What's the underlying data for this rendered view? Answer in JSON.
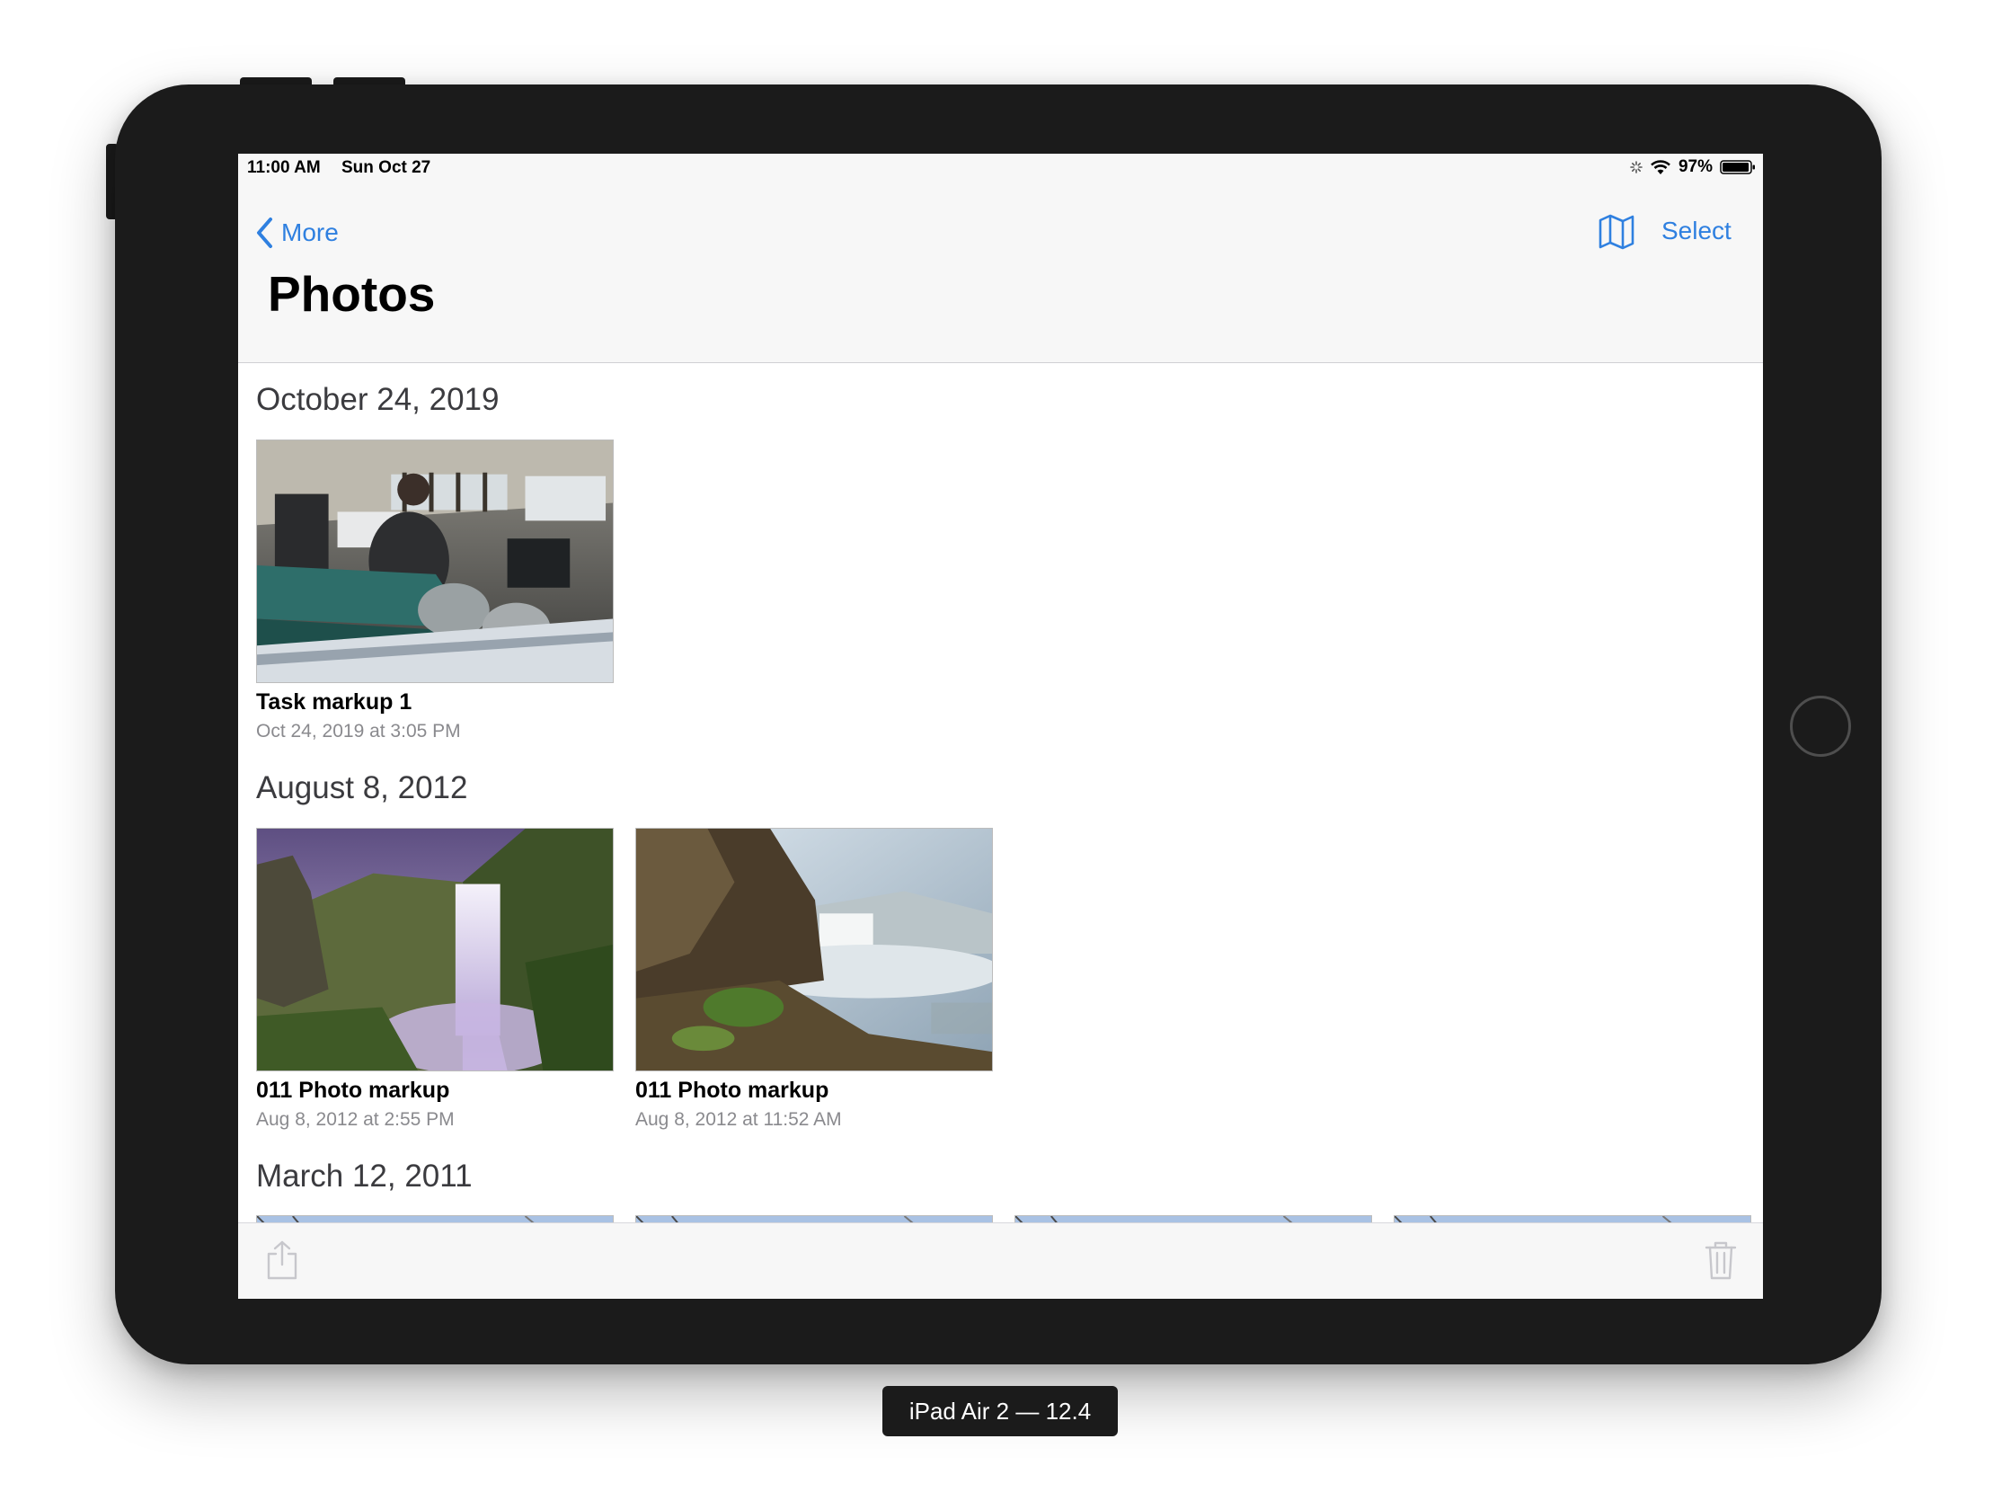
{
  "status_bar": {
    "time": "11:00 AM",
    "date": "Sun Oct 27",
    "battery": "97%",
    "battery_level": 0.97,
    "icons": [
      "activity-spinner-icon",
      "wifi-icon",
      "battery-icon"
    ]
  },
  "nav": {
    "back_label": "More",
    "select_label": "Select",
    "map_icon": "map-icon",
    "title": "Photos"
  },
  "sections": [
    {
      "date": "October 24, 2019",
      "photos": [
        {
          "title": "Task markup 1",
          "time": "Oct 24, 2019 at 3:05 PM"
        }
      ]
    },
    {
      "date": "August 8, 2012",
      "photos": [
        {
          "title": "011 Photo markup",
          "time": "Aug 8, 2012 at 2:55 PM"
        },
        {
          "title": "011 Photo markup",
          "time": "Aug 8, 2012 at 11:52 AM"
        }
      ]
    },
    {
      "date": "March 12, 2011",
      "photos": [
        {},
        {},
        {},
        {}
      ]
    }
  ],
  "toolbar": {
    "share_icon": "share-icon",
    "trash_icon": "trash-icon"
  },
  "device_label": "iPad Air 2 — 12.4",
  "colors": {
    "accent": "#2f80e0",
    "frame": "#1b1b1b",
    "bar_background": "#f7f7f7",
    "secondary_text": "#8a8a8e"
  }
}
